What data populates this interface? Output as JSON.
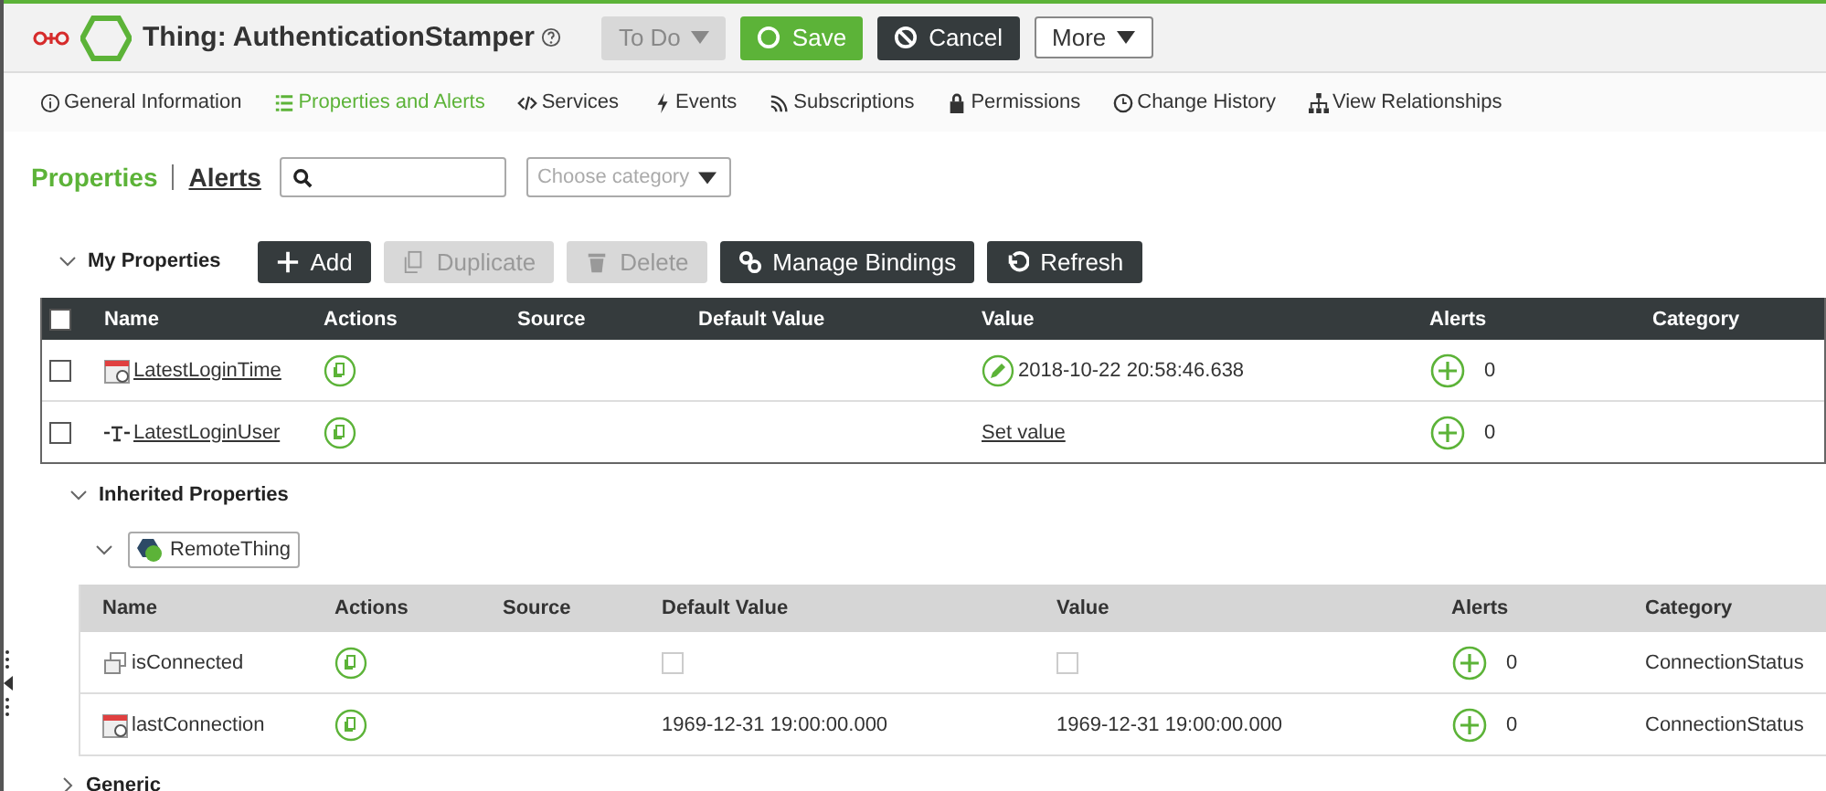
{
  "header": {
    "title": "Thing: AuthenticationStamper",
    "buttons": [
      {
        "label": "To Do",
        "kind": "dropdown",
        "disabled": true
      },
      {
        "label": "Save",
        "kind": "save",
        "disabled": false
      },
      {
        "label": "Cancel",
        "kind": "cancel",
        "disabled": false
      },
      {
        "label": "More",
        "kind": "more",
        "disabled": false
      }
    ]
  },
  "tabs": [
    {
      "label": "General Information",
      "selected": false
    },
    {
      "label": "Properties and Alerts",
      "selected": true
    },
    {
      "label": "Services",
      "selected": false
    },
    {
      "label": "Events",
      "selected": false
    },
    {
      "label": "Subscriptions",
      "selected": false
    },
    {
      "label": "Permissions",
      "selected": false
    },
    {
      "label": "Change History",
      "selected": false
    },
    {
      "label": "View Relationships",
      "selected": false
    }
  ],
  "subtabs": [
    {
      "label": "Properties",
      "selected": true
    },
    {
      "label": "Alerts",
      "selected": false
    }
  ],
  "category_select": {
    "placeholder": "Choose category"
  },
  "my_properties": {
    "title": "My Properties",
    "expanded": true,
    "toolbar": [
      {
        "label": "Add",
        "disabled": false
      },
      {
        "label": "Duplicate",
        "disabled": true
      },
      {
        "label": "Delete",
        "disabled": true
      },
      {
        "label": "Manage Bindings",
        "disabled": false
      },
      {
        "label": "Refresh",
        "disabled": false
      }
    ],
    "columns": [
      "Name",
      "Actions",
      "Source",
      "Default Value",
      "Value",
      "Alerts",
      "Category"
    ],
    "select_all_checked": false,
    "rows": [
      {
        "checked": false,
        "kind": "datetime",
        "name": "LatestLoginTime",
        "value": "2018-10-22 20:58:46.638",
        "alerts": "0"
      },
      {
        "checked": false,
        "kind": "string",
        "name": "LatestLoginUser",
        "value": "Set value",
        "alerts": "0"
      }
    ]
  },
  "inherited": {
    "title": "Inherited Properties",
    "expanded": true,
    "groups": [
      {
        "name": "RemoteThing",
        "expanded": true,
        "columns": [
          "Name",
          "Actions",
          "Source",
          "Default Value",
          "Value",
          "Alerts",
          "Category"
        ],
        "rows": [
          {
            "kind": "boolean",
            "name": "isConnected",
            "default_checked": false,
            "value_checked": false,
            "alerts": "0",
            "category": "ConnectionStatus"
          },
          {
            "kind": "datetime",
            "name": "lastConnection",
            "default_value": "1969-12-31 19:00:00.000",
            "value": "1969-12-31 19:00:00.000",
            "alerts": "0",
            "category": "ConnectionStatus"
          }
        ]
      }
    ]
  },
  "generic": {
    "title": "Generic",
    "expanded": false
  }
}
